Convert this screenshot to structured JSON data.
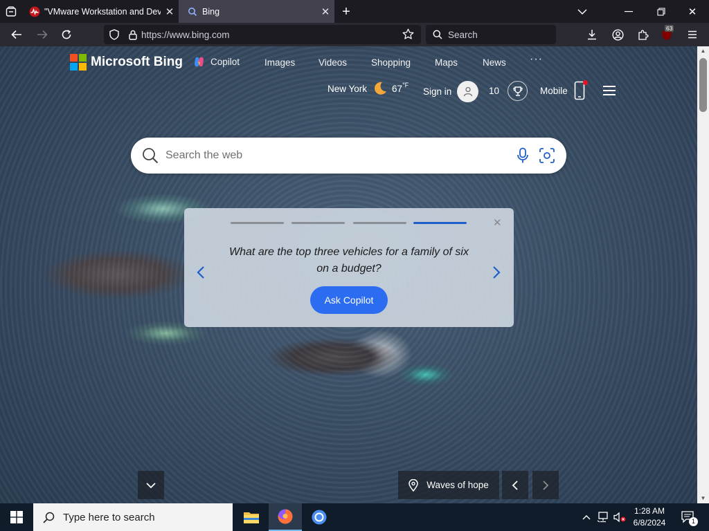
{
  "browser": {
    "tabs": [
      {
        "title": "\"VMware Workstation and Devic",
        "active": false
      },
      {
        "title": "Bing",
        "active": true
      }
    ],
    "url": "https://www.bing.com",
    "search_placeholder": "Search",
    "extensions_badge": "63"
  },
  "bing": {
    "logo_text": "Microsoft Bing",
    "nav": [
      "Copilot",
      "Images",
      "Videos",
      "Shopping",
      "Maps",
      "News"
    ],
    "more": "···",
    "location": "New York",
    "temperature": "67",
    "temp_unit": "°F",
    "sign_in": "Sign in",
    "rewards_points": "10",
    "mobile": "Mobile",
    "search_placeholder": "Search the web"
  },
  "copilot_card": {
    "question": "What are the top three vehicles for a family of six on a budget?",
    "button": "Ask Copilot",
    "active_step": 4,
    "steps": 4
  },
  "image_info": {
    "caption": "Waves of hope"
  },
  "taskbar": {
    "search_placeholder": "Type here to search",
    "time": "1:28 AM",
    "date": "6/8/2024",
    "notification_count": "1"
  },
  "colors": {
    "accent": "#2b6cf0",
    "progress_active": "#1f5ec8",
    "tab_active": "#42414d",
    "toolbar": "#2b2a33"
  }
}
